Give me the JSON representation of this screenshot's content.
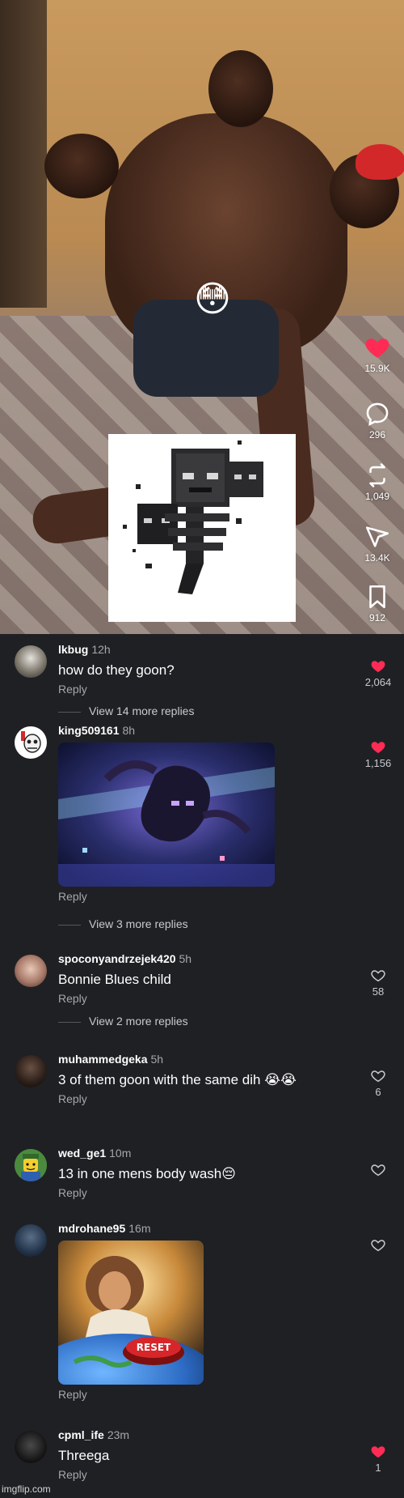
{
  "video": {
    "reaction_emoji": "😳",
    "actions": [
      {
        "icon": "heart-icon",
        "count": "15.9K",
        "active": true
      },
      {
        "icon": "comment-icon",
        "count": "296",
        "active": false
      },
      {
        "icon": "repost-icon",
        "count": "1,049",
        "active": false
      },
      {
        "icon": "share-icon",
        "count": "13.4K",
        "active": false
      },
      {
        "icon": "bookmark-icon",
        "count": "912",
        "active": false
      }
    ]
  },
  "colors": {
    "liked": "#fe2c55",
    "muted_text": "#a6a7ab",
    "background": "#1f2024"
  },
  "comments": [
    {
      "user": "lkbug",
      "time": "12h",
      "text": "how do they goon?",
      "reply": "Reply",
      "likes": "2,064",
      "liked": true,
      "view_more": "View 14 more replies"
    },
    {
      "user": "king509161",
      "time": "8h",
      "text": "",
      "reply": "Reply",
      "likes": "1,156",
      "liked": true,
      "view_more": "View 3 more replies",
      "image": "minecraft-wither-storm-image"
    },
    {
      "user": "spoconyandrzejek420",
      "time": "5h",
      "text": "Bonnie Blues child",
      "reply": "Reply",
      "likes": "58",
      "liked": false,
      "view_more": "View 2 more replies"
    },
    {
      "user": "muhammedgeka",
      "time": "5h",
      "text": "3 of them goon with the same dih 😭😭",
      "reply": "Reply",
      "likes": "6",
      "liked": false
    },
    {
      "user": "wed_ge1",
      "time": "10m",
      "text": "13 in one mens body wash😔",
      "reply": "Reply",
      "likes": "",
      "liked": false
    },
    {
      "user": "mdrohane95",
      "time": "16m",
      "text": "",
      "reply": "Reply",
      "likes": "",
      "liked": false,
      "image": "jesus-reset-button-image"
    },
    {
      "user": "cpml_ife",
      "time": "23m",
      "text": "Threega",
      "reply": "Reply",
      "likes": "1",
      "liked": true
    }
  ],
  "reset_button_text": "RESET",
  "watermark": "imgflip.com"
}
